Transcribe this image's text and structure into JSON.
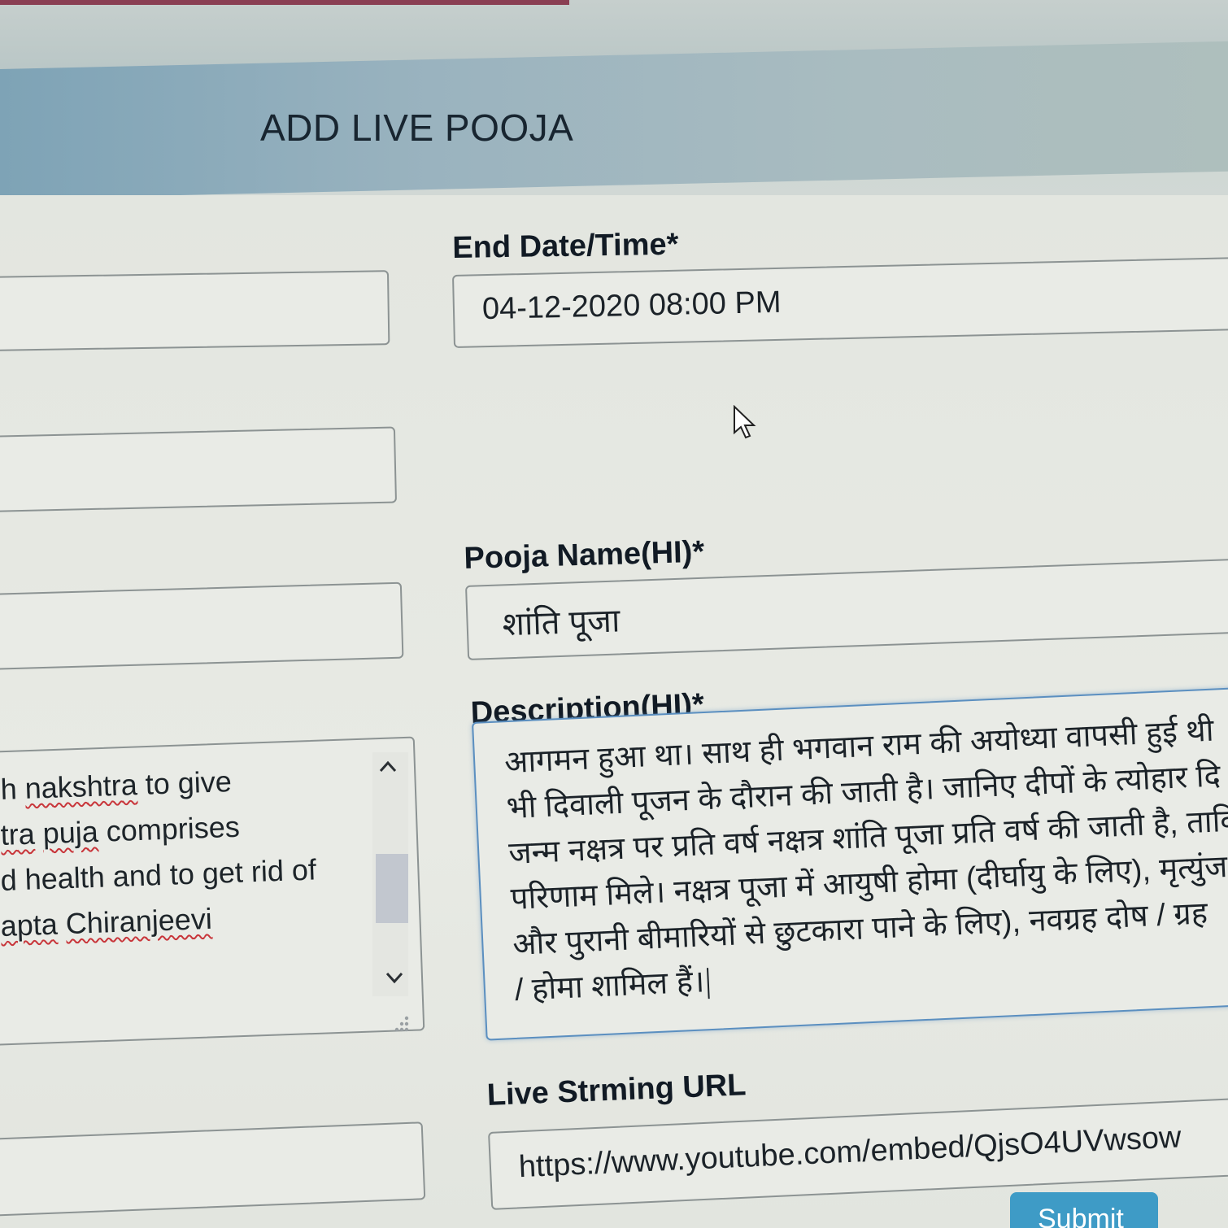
{
  "header": {
    "title": "ADD LIVE POOJA"
  },
  "fields": {
    "end_datetime": {
      "label": "End Date/Time*",
      "value": "04-12-2020 08:00 PM"
    },
    "pooja_name_hi": {
      "label": "Pooja Name(HI)*",
      "value": "शांति पूजा"
    },
    "description_hi": {
      "label": "Description(HI)*",
      "lines": [
        "आगमन हुआ था। साथ ही भगवान राम की अयोध्या वापसी हुई थी",
        "भी दिवाली पूजन के दौरान की जाती है। जानिए दीपों के त्योहार दि",
        "जन्म नक्षत्र पर प्रति वर्ष नक्षत्र शांति पूजा प्रति वर्ष की जाती है, ताकि",
        "परिणाम मिले। नक्षत्र पूजा में आयुषी होमा (दीर्घायु के लिए), मृत्युंज",
        "और पुरानी बीमारियों से छुटकारा पाने के लिए), नवग्रह दोष / ग्रह",
        "/ होमा शामिल हैं।"
      ]
    },
    "live_streaming_url": {
      "label": "Live Strming URL",
      "value": "https://www.youtube.com/embed/QjsO4UVwsow"
    }
  },
  "left_description": {
    "line1_a": "h ",
    "line1_b": "nakshtra",
    "line1_c": " to give",
    "line2_a": "tra",
    "line2_b": " ",
    "line2_c": "puja",
    "line2_d": " comprises",
    "line3": "d health and to get rid of",
    "line4_a": "apta",
    "line4_b": " ",
    "line4_c": "Chiranjeevi"
  },
  "submit": {
    "label": "Submit"
  },
  "colors": {
    "header_bg": "#9ab3bf",
    "title_text": "#182530",
    "focus_border": "#5b8fc0",
    "submit_bg": "#3e9bc6",
    "spellcheck_underline": "#c8353a"
  }
}
